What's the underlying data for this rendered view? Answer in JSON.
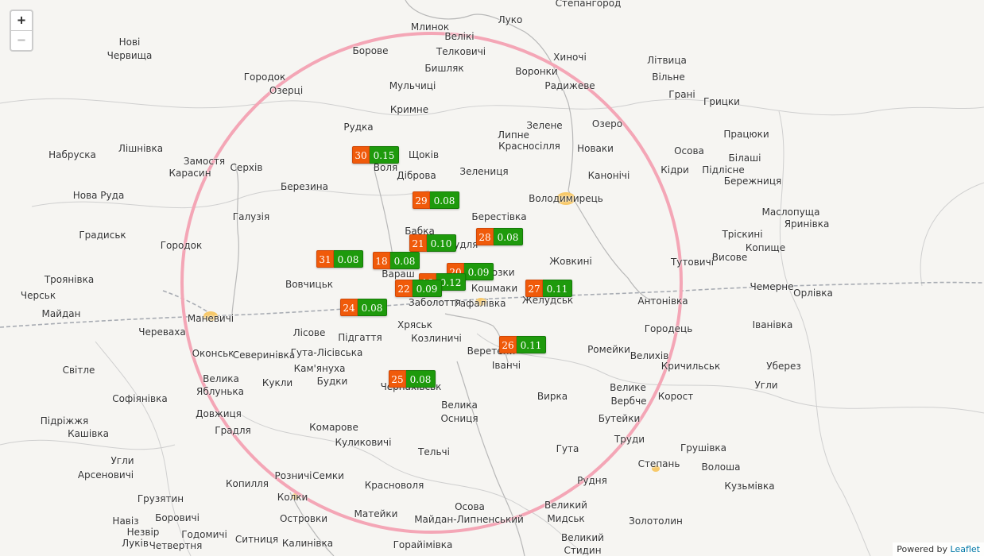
{
  "zoom": {
    "in_label": "+",
    "out_label": "−"
  },
  "attribution": {
    "prefix": "Powered by ",
    "link_label": "Leaflet"
  },
  "colors": {
    "count_bg": "#f05a0a",
    "value_bg": "#1e9a0c",
    "circle": "#f4a6b6",
    "railway": "#a8acb3"
  },
  "places": [
    "Нові",
    "Червища",
    "Городок",
    "Озерці",
    "Рудка",
    "Набруска",
    "Лішнівка",
    "Замостя",
    "Карасин",
    "Серхів",
    "Березина",
    "Нова Руда",
    "Галузія",
    "Градиськ",
    "Городок",
    "Троянівка",
    "Черськ",
    "Вовчицьк",
    "Майдан",
    "Маневичі",
    "Череваха",
    "Лісове",
    "Підгаття",
    "Хряськ",
    "Козлиничі",
    "Оконськ",
    "Северинівка",
    "Гута-Лісівська",
    "Кам'януха",
    "Будки",
    "Кукли",
    "Велика",
    "Яблунька",
    "Світле",
    "Софіянівка",
    "Довжиця",
    "Градля",
    "Підріжжя",
    "Кашівка",
    "Комарове",
    "Куликовичі",
    "Угли",
    "Арсеновичі",
    "Тельчі",
    "Велика",
    "Осниця",
    "Грузятин",
    "Копилля",
    "Розничі",
    "Семки",
    "Колки",
    "Красноволя",
    "Острoвки",
    "Матейки",
    "Осова",
    "Майдан-Липненський",
    "Навіз",
    "Незвір",
    "Луків",
    "Боровичі",
    "Четвертня",
    "Годомичі",
    "Ситниця",
    "Калинівка",
    "Горайiмівка",
    "Млинок",
    "Луко",
    "Степангород",
    "Велікі",
    "Телковичі",
    "Борове",
    "Бишляк",
    "Мульчиці",
    "Воронки",
    "Хиночі",
    "Радижеве",
    "Кримне",
    "Зелене",
    "Липне",
    "Красносілля",
    "Щоків",
    "Діброва",
    "Воля",
    "Зелениця",
    "Озеро",
    "Новаки",
    "Канонічі",
    "Володимирець",
    "Берестівка",
    "Бабка",
    "Кудля",
    "Вараш",
    "Жовкині",
    "Кошмаки",
    "Рафалівка",
    "Заболоття",
    "Мозки",
    "Желудськ",
    "Антонівка",
    "Тутовичі",
    "Висове",
    "Трiскині",
    "Копище",
    "Маслопуща",
    "Яринівка",
    "Чемерне",
    "Орлівка",
    "Літвица",
    "Вільне",
    "Грані",
    "Грицки",
    "Працюки",
    "Осова",
    "Білаші",
    "Кідри",
    "Підлісне",
    "Бережниця",
    "Городець",
    "Іванівка",
    "Веретени",
    "Іванчі",
    "Ромейки",
    "Велихів",
    "Кричильськ",
    "Уберез",
    "Угли",
    "Велике",
    "Вербче",
    "Корост",
    "Бутейки",
    "Вирка",
    "Труди",
    "Гута",
    "Грушівка",
    "Степань",
    "Волоша",
    "Кузьмівка",
    "Рудня",
    "Великий",
    "Мидськ",
    "Золотолин",
    "Великий",
    "Стидин",
    "Чернахівськ"
  ],
  "markers": [
    {
      "count": "30",
      "value": "0.15"
    },
    {
      "count": "29",
      "value": "0.08"
    },
    {
      "count": "28",
      "value": "0.08"
    },
    {
      "count": "21",
      "value": "0.10"
    },
    {
      "count": "31",
      "value": "0.08"
    },
    {
      "count": "18",
      "value": "0.08"
    },
    {
      "count": "20",
      "value": "0.09"
    },
    {
      "count": "19",
      "value": "0.12"
    },
    {
      "count": "22",
      "value": "0.09"
    },
    {
      "count": "27",
      "value": "0.11"
    },
    {
      "count": "24",
      "value": "0.08"
    },
    {
      "count": "26",
      "value": "0.11"
    },
    {
      "count": "25",
      "value": "0.08"
    }
  ]
}
